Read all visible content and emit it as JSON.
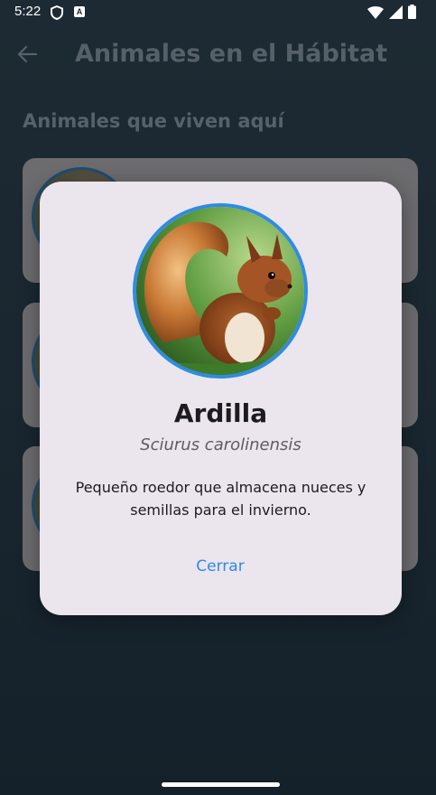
{
  "status_bar": {
    "time": "5:22",
    "icons": [
      "shield-icon",
      "a-icon",
      "wifi-icon",
      "signal-icon",
      "battery-icon"
    ]
  },
  "app_bar": {
    "back_icon": "back-arrow-icon",
    "title": "Animales en el Hábitat"
  },
  "section": {
    "title": "Animales que viven aquí"
  },
  "dialog": {
    "name": "Ardilla",
    "scientific_name": "Sciurus carolinensis",
    "description": "Pequeño roedor que almacena nueces y semillas para el invierno.",
    "close_label": "Cerrar",
    "accent_color": "#2e8ce2"
  }
}
